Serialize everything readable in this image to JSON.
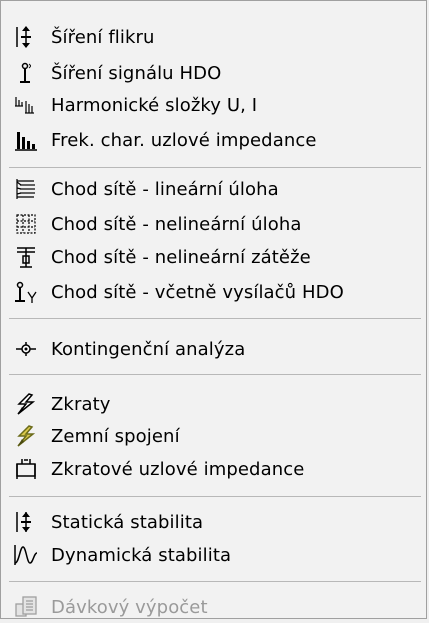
{
  "menu": {
    "items": [
      {
        "label": "Šíření flikru",
        "icon": "flicker-icon"
      },
      {
        "label": "Šíření signálu HDO",
        "icon": "hdo-signal-icon"
      },
      {
        "label": "Harmonické složky U, I",
        "icon": "harmonics-icon"
      },
      {
        "label": "Frek. char. uzlové impedance",
        "icon": "frequency-chart-icon"
      },
      {
        "label": "Chod sítě - lineární úloha",
        "icon": "network-linear-icon"
      },
      {
        "label": "Chod sítě - nelineární úloha",
        "icon": "network-nonlinear-icon"
      },
      {
        "label": "Chod sítě - nelineární zátěže",
        "icon": "nonlinear-load-icon"
      },
      {
        "label": "Chod sítě - včetně vysílačů HDO",
        "icon": "hdo-transmitter-icon"
      },
      {
        "label": "Kontingenční analýza",
        "icon": "contingency-icon"
      },
      {
        "label": "Zkraty",
        "icon": "short-circuit-icon"
      },
      {
        "label": "Zemní spojení",
        "icon": "earth-fault-icon"
      },
      {
        "label": "Zkratové uzlové impedance",
        "icon": "short-circuit-impedance-icon"
      },
      {
        "label": "Statická stabilita",
        "icon": "static-stability-icon"
      },
      {
        "label": "Dynamická stabilita",
        "icon": "dynamic-stability-icon"
      },
      {
        "label": "Dávkový výpočet",
        "icon": "batch-calculation-icon",
        "disabled": true
      }
    ]
  }
}
